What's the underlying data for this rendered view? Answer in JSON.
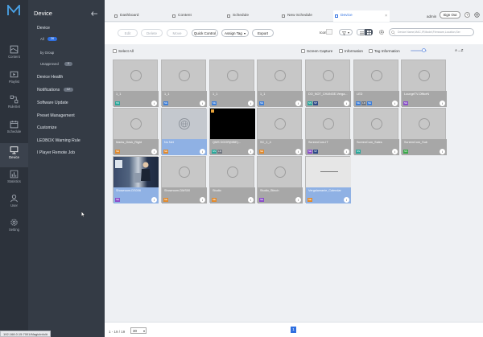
{
  "rail": [
    {
      "label": "Content",
      "icon": "content-icon"
    },
    {
      "label": "Playlist",
      "icon": "playlist-icon"
    },
    {
      "label": "RuleSet",
      "icon": "ruleset-icon"
    },
    {
      "label": "Schedule",
      "icon": "schedule-icon"
    },
    {
      "label": "Device",
      "icon": "device-icon",
      "active": true
    },
    {
      "label": "Statistics",
      "icon": "statistics-icon"
    },
    {
      "label": "User",
      "icon": "user-icon"
    },
    {
      "label": "Setting",
      "icon": "setting-icon"
    }
  ],
  "menu": {
    "title": "Device",
    "device": "Device",
    "all_label": "All",
    "all_count": "26",
    "by_group": "by Group",
    "unapproved_label": "Unapproved",
    "unapproved_count": "0",
    "items": [
      "Device Health",
      "Notifications",
      "Software Update",
      "Preset Management",
      "Customize",
      "LEDBOX Warning Rule",
      "I Player Remote Job"
    ],
    "notifications_count": "12"
  },
  "tabs": [
    {
      "label": "Dashboard"
    },
    {
      "label": "Content"
    },
    {
      "label": "Schedule"
    },
    {
      "label": "New Schedule"
    },
    {
      "label": "Device",
      "active": true
    }
  ],
  "header": {
    "user": "admin",
    "signout": "Sign Out",
    "help": "?"
  },
  "toolbar": {
    "edit": "Edit",
    "delete": "Delete",
    "move": "Move",
    "quick_control": "Quick Control",
    "assign_tag": "Assign Tag",
    "export": "Export",
    "icon_label": "Icon",
    "search_placeholder": "Device Name,MAC,IP,Model,Firmware,Location,Ser"
  },
  "options": {
    "select_all": "Select All",
    "screen_capture": "Screen Capture",
    "information": "Information",
    "tag_information": "Tag Information",
    "sort": "A→Z",
    "thumb_size_fraction": 0.8
  },
  "devices": [
    {
      "name": "1_1",
      "badges": [
        {
          "t": "SS",
          "c": "#2aa79b"
        }
      ]
    },
    {
      "name": "1_1",
      "badges": [
        {
          "t": "SE",
          "c": "#3f7fd8"
        }
      ]
    },
    {
      "name": "1_1",
      "badges": [
        {
          "t": "SE",
          "c": "#3f7fd8"
        }
      ]
    },
    {
      "name": "1_1",
      "badges": [
        {
          "t": "SE",
          "c": "#3f7fd8"
        }
      ]
    },
    {
      "name": "DO_NOT_CHANGE-Verga...",
      "badges": [
        {
          "t": "SS",
          "c": "#2aa79b"
        },
        {
          "t": "SP",
          "c": "#2e4a88"
        }
      ]
    },
    {
      "name": "LED",
      "badges": [
        {
          "t": "SE",
          "c": "#3f7fd8"
        },
        {
          "t": "LD",
          "c": "#6f7681"
        },
        {
          "t": "SE",
          "c": "#3f7fd8"
        }
      ]
    },
    {
      "name": "LoungeTV-OfficeN",
      "badges": [
        {
          "t": "SE",
          "c": "#8a4fc9"
        }
      ]
    },
    {
      "name": "Marks_Desk_Right",
      "badges": [
        {
          "t": "SE",
          "c": "#e08a2e"
        }
      ]
    },
    {
      "name": "No Net",
      "badges": [
        {
          "t": "SE",
          "c": "#e08a2e"
        }
      ],
      "sel": true,
      "net": true
    },
    {
      "name": "QMS DOOR(MBE)...",
      "badges": [
        {
          "t": "SS",
          "c": "#2aa79b"
        },
        {
          "t": "LD",
          "c": "#6f7681"
        }
      ],
      "dark": true
    },
    {
      "name": "SC_1_4",
      "badges": [
        {
          "t": "SE",
          "c": "#e08a2e"
        }
      ]
    },
    {
      "name": "ScreenCom-IT",
      "badges": [
        {
          "t": "SE",
          "c": "#8a4fc9"
        },
        {
          "t": "SP",
          "c": "#2e4a88"
        }
      ]
    },
    {
      "name": "ScreenCom_Sales",
      "badges": [
        {
          "t": "SS",
          "c": "#2aa79b"
        }
      ]
    },
    {
      "name": "ScreenCom_Sub",
      "badges": [
        {
          "t": "SS",
          "c": "#3aa84a"
        }
      ]
    },
    {
      "name": "Showroom-DS006",
      "badges": [
        {
          "t": "SE",
          "c": "#8a4fc9"
        }
      ],
      "sel": true,
      "photo": true
    },
    {
      "name": "Showroom-DMS00",
      "badges": [
        {
          "t": "SE",
          "c": "#e08a2e"
        }
      ]
    },
    {
      "name": "Studio",
      "badges": [
        {
          "t": "SE",
          "c": "#e08a2e"
        }
      ]
    },
    {
      "name": "Studio_Stinch",
      "badges": [
        {
          "t": "SE",
          "c": "#8a4fc9"
        }
      ]
    },
    {
      "name": "Vergalamanie_Calendar",
      "badges": [
        {
          "t": "SE",
          "c": "#e08a2e"
        }
      ],
      "sel": true,
      "blank": true
    }
  ],
  "pager": {
    "range": "1 - 19 / 19",
    "page_size": "30",
    "page": "1"
  },
  "status_url": "192.168.0.15:7001/MagicInfo/#"
}
